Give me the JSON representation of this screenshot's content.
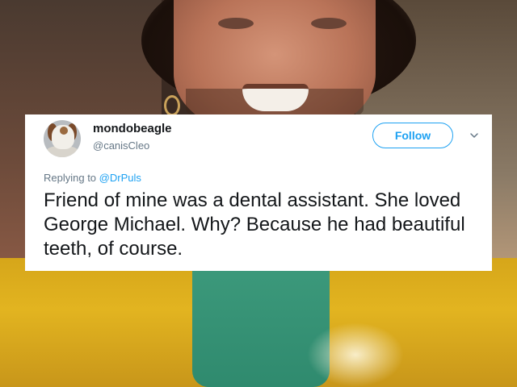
{
  "tweet": {
    "display_name": "mondobeagle",
    "handle": "@canisCleo",
    "follow_label": "Follow",
    "replying_to_prefix": "Replying to ",
    "replying_to_handle": "@DrPuls",
    "text": "Friend of mine was a dental assistant. She loved George Michael. Why? Because he had beautiful teeth, of course."
  },
  "colors": {
    "accent": "#1da1f2",
    "text_primary": "#14171a",
    "text_secondary": "#657786"
  },
  "icons": {
    "menu": "chevron-down-icon",
    "avatar": "beagle-avatar"
  }
}
